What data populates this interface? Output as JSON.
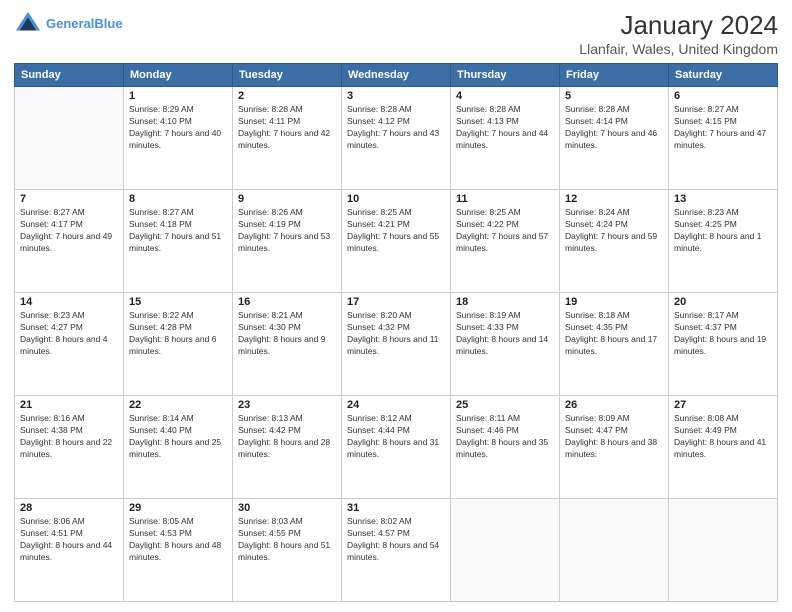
{
  "header": {
    "logo_line1": "General",
    "logo_line2": "Blue",
    "title": "January 2024",
    "subtitle": "Llanfair, Wales, United Kingdom"
  },
  "days_of_week": [
    "Sunday",
    "Monday",
    "Tuesday",
    "Wednesday",
    "Thursday",
    "Friday",
    "Saturday"
  ],
  "weeks": [
    [
      {
        "day": "",
        "sunrise": "",
        "sunset": "",
        "daylight": ""
      },
      {
        "day": "1",
        "sunrise": "Sunrise: 8:29 AM",
        "sunset": "Sunset: 4:10 PM",
        "daylight": "Daylight: 7 hours and 40 minutes."
      },
      {
        "day": "2",
        "sunrise": "Sunrise: 8:28 AM",
        "sunset": "Sunset: 4:11 PM",
        "daylight": "Daylight: 7 hours and 42 minutes."
      },
      {
        "day": "3",
        "sunrise": "Sunrise: 8:28 AM",
        "sunset": "Sunset: 4:12 PM",
        "daylight": "Daylight: 7 hours and 43 minutes."
      },
      {
        "day": "4",
        "sunrise": "Sunrise: 8:28 AM",
        "sunset": "Sunset: 4:13 PM",
        "daylight": "Daylight: 7 hours and 44 minutes."
      },
      {
        "day": "5",
        "sunrise": "Sunrise: 8:28 AM",
        "sunset": "Sunset: 4:14 PM",
        "daylight": "Daylight: 7 hours and 46 minutes."
      },
      {
        "day": "6",
        "sunrise": "Sunrise: 8:27 AM",
        "sunset": "Sunset: 4:15 PM",
        "daylight": "Daylight: 7 hours and 47 minutes."
      }
    ],
    [
      {
        "day": "7",
        "sunrise": "Sunrise: 8:27 AM",
        "sunset": "Sunset: 4:17 PM",
        "daylight": "Daylight: 7 hours and 49 minutes."
      },
      {
        "day": "8",
        "sunrise": "Sunrise: 8:27 AM",
        "sunset": "Sunset: 4:18 PM",
        "daylight": "Daylight: 7 hours and 51 minutes."
      },
      {
        "day": "9",
        "sunrise": "Sunrise: 8:26 AM",
        "sunset": "Sunset: 4:19 PM",
        "daylight": "Daylight: 7 hours and 53 minutes."
      },
      {
        "day": "10",
        "sunrise": "Sunrise: 8:25 AM",
        "sunset": "Sunset: 4:21 PM",
        "daylight": "Daylight: 7 hours and 55 minutes."
      },
      {
        "day": "11",
        "sunrise": "Sunrise: 8:25 AM",
        "sunset": "Sunset: 4:22 PM",
        "daylight": "Daylight: 7 hours and 57 minutes."
      },
      {
        "day": "12",
        "sunrise": "Sunrise: 8:24 AM",
        "sunset": "Sunset: 4:24 PM",
        "daylight": "Daylight: 7 hours and 59 minutes."
      },
      {
        "day": "13",
        "sunrise": "Sunrise: 8:23 AM",
        "sunset": "Sunset: 4:25 PM",
        "daylight": "Daylight: 8 hours and 1 minute."
      }
    ],
    [
      {
        "day": "14",
        "sunrise": "Sunrise: 8:23 AM",
        "sunset": "Sunset: 4:27 PM",
        "daylight": "Daylight: 8 hours and 4 minutes."
      },
      {
        "day": "15",
        "sunrise": "Sunrise: 8:22 AM",
        "sunset": "Sunset: 4:28 PM",
        "daylight": "Daylight: 8 hours and 6 minutes."
      },
      {
        "day": "16",
        "sunrise": "Sunrise: 8:21 AM",
        "sunset": "Sunset: 4:30 PM",
        "daylight": "Daylight: 8 hours and 9 minutes."
      },
      {
        "day": "17",
        "sunrise": "Sunrise: 8:20 AM",
        "sunset": "Sunset: 4:32 PM",
        "daylight": "Daylight: 8 hours and 11 minutes."
      },
      {
        "day": "18",
        "sunrise": "Sunrise: 8:19 AM",
        "sunset": "Sunset: 4:33 PM",
        "daylight": "Daylight: 8 hours and 14 minutes."
      },
      {
        "day": "19",
        "sunrise": "Sunrise: 8:18 AM",
        "sunset": "Sunset: 4:35 PM",
        "daylight": "Daylight: 8 hours and 17 minutes."
      },
      {
        "day": "20",
        "sunrise": "Sunrise: 8:17 AM",
        "sunset": "Sunset: 4:37 PM",
        "daylight": "Daylight: 8 hours and 19 minutes."
      }
    ],
    [
      {
        "day": "21",
        "sunrise": "Sunrise: 8:16 AM",
        "sunset": "Sunset: 4:38 PM",
        "daylight": "Daylight: 8 hours and 22 minutes."
      },
      {
        "day": "22",
        "sunrise": "Sunrise: 8:14 AM",
        "sunset": "Sunset: 4:40 PM",
        "daylight": "Daylight: 8 hours and 25 minutes."
      },
      {
        "day": "23",
        "sunrise": "Sunrise: 8:13 AM",
        "sunset": "Sunset: 4:42 PM",
        "daylight": "Daylight: 8 hours and 28 minutes."
      },
      {
        "day": "24",
        "sunrise": "Sunrise: 8:12 AM",
        "sunset": "Sunset: 4:44 PM",
        "daylight": "Daylight: 8 hours and 31 minutes."
      },
      {
        "day": "25",
        "sunrise": "Sunrise: 8:11 AM",
        "sunset": "Sunset: 4:46 PM",
        "daylight": "Daylight: 8 hours and 35 minutes."
      },
      {
        "day": "26",
        "sunrise": "Sunrise: 8:09 AM",
        "sunset": "Sunset: 4:47 PM",
        "daylight": "Daylight: 8 hours and 38 minutes."
      },
      {
        "day": "27",
        "sunrise": "Sunrise: 8:08 AM",
        "sunset": "Sunset: 4:49 PM",
        "daylight": "Daylight: 8 hours and 41 minutes."
      }
    ],
    [
      {
        "day": "28",
        "sunrise": "Sunrise: 8:06 AM",
        "sunset": "Sunset: 4:51 PM",
        "daylight": "Daylight: 8 hours and 44 minutes."
      },
      {
        "day": "29",
        "sunrise": "Sunrise: 8:05 AM",
        "sunset": "Sunset: 4:53 PM",
        "daylight": "Daylight: 8 hours and 48 minutes."
      },
      {
        "day": "30",
        "sunrise": "Sunrise: 8:03 AM",
        "sunset": "Sunset: 4:55 PM",
        "daylight": "Daylight: 8 hours and 51 minutes."
      },
      {
        "day": "31",
        "sunrise": "Sunrise: 8:02 AM",
        "sunset": "Sunset: 4:57 PM",
        "daylight": "Daylight: 8 hours and 54 minutes."
      },
      {
        "day": "",
        "sunrise": "",
        "sunset": "",
        "daylight": ""
      },
      {
        "day": "",
        "sunrise": "",
        "sunset": "",
        "daylight": ""
      },
      {
        "day": "",
        "sunrise": "",
        "sunset": "",
        "daylight": ""
      }
    ]
  ]
}
